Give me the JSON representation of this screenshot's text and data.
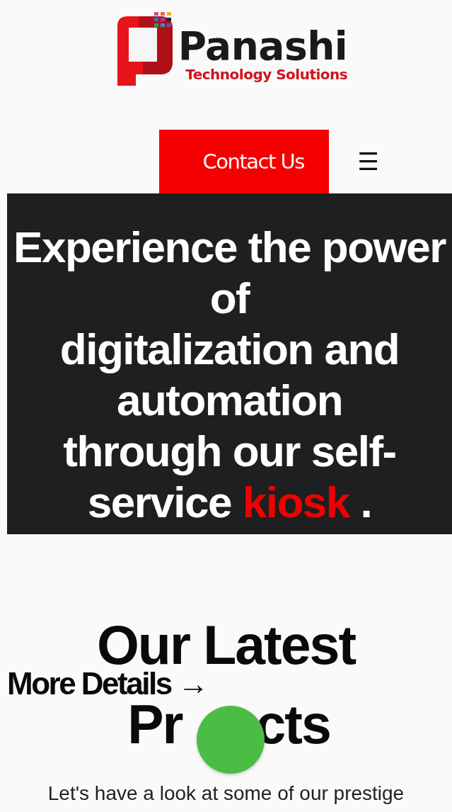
{
  "header": {
    "logo": {
      "name": "Panashi",
      "tagline": "Technology Solutions"
    },
    "contact_button": "Contact Us",
    "menu_icon": "☰"
  },
  "hero": {
    "parts": [
      {
        "kind": "text",
        "text": "Experience the power of"
      },
      {
        "kind": "break"
      },
      {
        "kind": "text",
        "text": "digitalization and automation"
      },
      {
        "kind": "break"
      },
      {
        "kind": "text",
        "text": "through our self-service "
      },
      {
        "kind": "accent",
        "text": "kiosk"
      },
      {
        "kind": "text",
        "text": " ."
      }
    ]
  },
  "projects": {
    "title_parts": [
      "Our Latest",
      "Pr",
      "cts"
    ],
    "more_link": "More Details →",
    "intro": "Let's have a look at some of our prestige"
  }
}
